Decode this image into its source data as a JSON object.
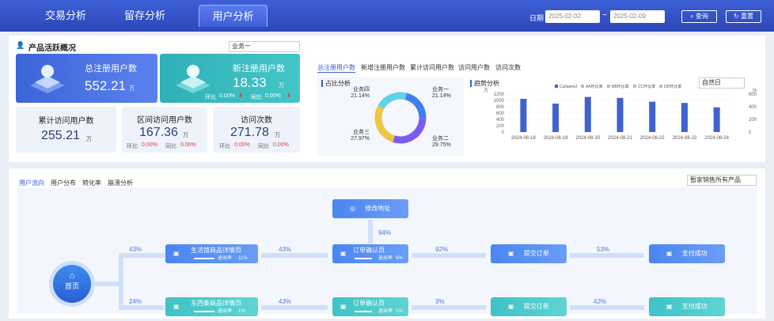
{
  "topbar": {
    "tabs": [
      {
        "label": "交易分析"
      },
      {
        "label": "留存分析"
      },
      {
        "label": "用户分析"
      }
    ],
    "date_label": "日期",
    "start_date": "2025-02-02",
    "end_date": "2025-02-09",
    "range_sep": "~",
    "query_label": "查询",
    "reset_label": "重置"
  },
  "overview": {
    "title": "产品活跃概况",
    "selector": "业务一",
    "registered": {
      "title": "总注册用户数",
      "value": "552.21",
      "unit": "万"
    },
    "new_registered": {
      "title": "新注册用户数",
      "value": "18.33",
      "unit": "万",
      "hb_label": "环比",
      "hb": "0.00%",
      "tb_label": "同比",
      "tb": "0.00%"
    },
    "cumulative": {
      "title": "累计访问用户数",
      "value": "255.21",
      "unit": "万"
    },
    "range_visits": {
      "title": "区间访问用户数",
      "value": "167.36",
      "unit": "万",
      "hb_label": "环比",
      "hb": "0.00%",
      "tb_label": "同比",
      "tb": "0.00%"
    },
    "visits": {
      "title": "访问次数",
      "value": "271.78",
      "unit": "万",
      "hb_label": "环比",
      "hb": "0.00%",
      "tb_label": "同比",
      "tb": "0.00%"
    }
  },
  "subtabs": [
    "总注册用户数",
    "新增注册用户数",
    "累计访问用户数",
    "访问用户数",
    "访问次数"
  ],
  "share_title": "占比分析",
  "trend_title": "趋势分析",
  "trend_selector": "自然日",
  "chart_data": [
    {
      "type": "pie",
      "title": "占比分析",
      "labels": [
        "业务一",
        "业务二",
        "业务三",
        "业务四"
      ],
      "values": [
        21.14,
        29.75,
        27.97,
        21.14
      ],
      "label_text": [
        "21.14%",
        "29.75%",
        "27.97%",
        "21.14%"
      ],
      "colors": [
        "#3f7ef0",
        "#7b5cf0",
        "#f0c545",
        "#5fd3e8"
      ]
    },
    {
      "type": "bar",
      "title": "趋势分析",
      "legend": [
        "CuName2",
        "AA环比率",
        "BB环比率",
        "CC环比率",
        "DD环比率"
      ],
      "categories": [
        "2024-08-18",
        "2024-08-19",
        "2024-08-20",
        "2024-08-21",
        "2024-08-22",
        "2024-08-23",
        "2024-08-24"
      ],
      "values": [
        1050,
        900,
        1110,
        1080,
        960,
        920,
        780
      ],
      "ylabel": "万",
      "y2label": "%",
      "ylim": [
        0,
        1200
      ],
      "y2lim": [
        0,
        600
      ],
      "yticks": [
        "1200",
        "1000",
        "800",
        "600",
        "400",
        "200",
        "0"
      ],
      "y2ticks": [
        "600",
        "400",
        "200",
        "0"
      ],
      "color": "#3f62d0"
    }
  ],
  "flow": {
    "tabs": [
      "用户流向",
      "用户分布",
      "转化率",
      "崩溃分析"
    ],
    "selector": "暂家销售所有产品",
    "home_label": "首页",
    "modify_label": "修改地址",
    "row1": {
      "in_pct": "43%",
      "node1": {
        "label": "生活馆商品详情页",
        "exit_label": "退出率",
        "exit": "11%"
      },
      "p1": "43%",
      "node2": {
        "label": "订单确认页",
        "exit_label": "退出率",
        "exit": "5%"
      },
      "p2": "92%",
      "node3": "提交订单",
      "p3": "53%",
      "node4": "支付成功",
      "up_pct": "94%"
    },
    "row2": {
      "in_pct": "24%",
      "node1": {
        "label": "东西集商品详情页",
        "exit_label": "退出率",
        "exit": "1%"
      },
      "p1": "43%",
      "node2": {
        "label": "订单确认页",
        "exit_label": "退出率",
        "exit": "1%"
      },
      "p2": "3%",
      "node3": "提交订单",
      "p3": "42%",
      "node4": "支付成功"
    }
  }
}
